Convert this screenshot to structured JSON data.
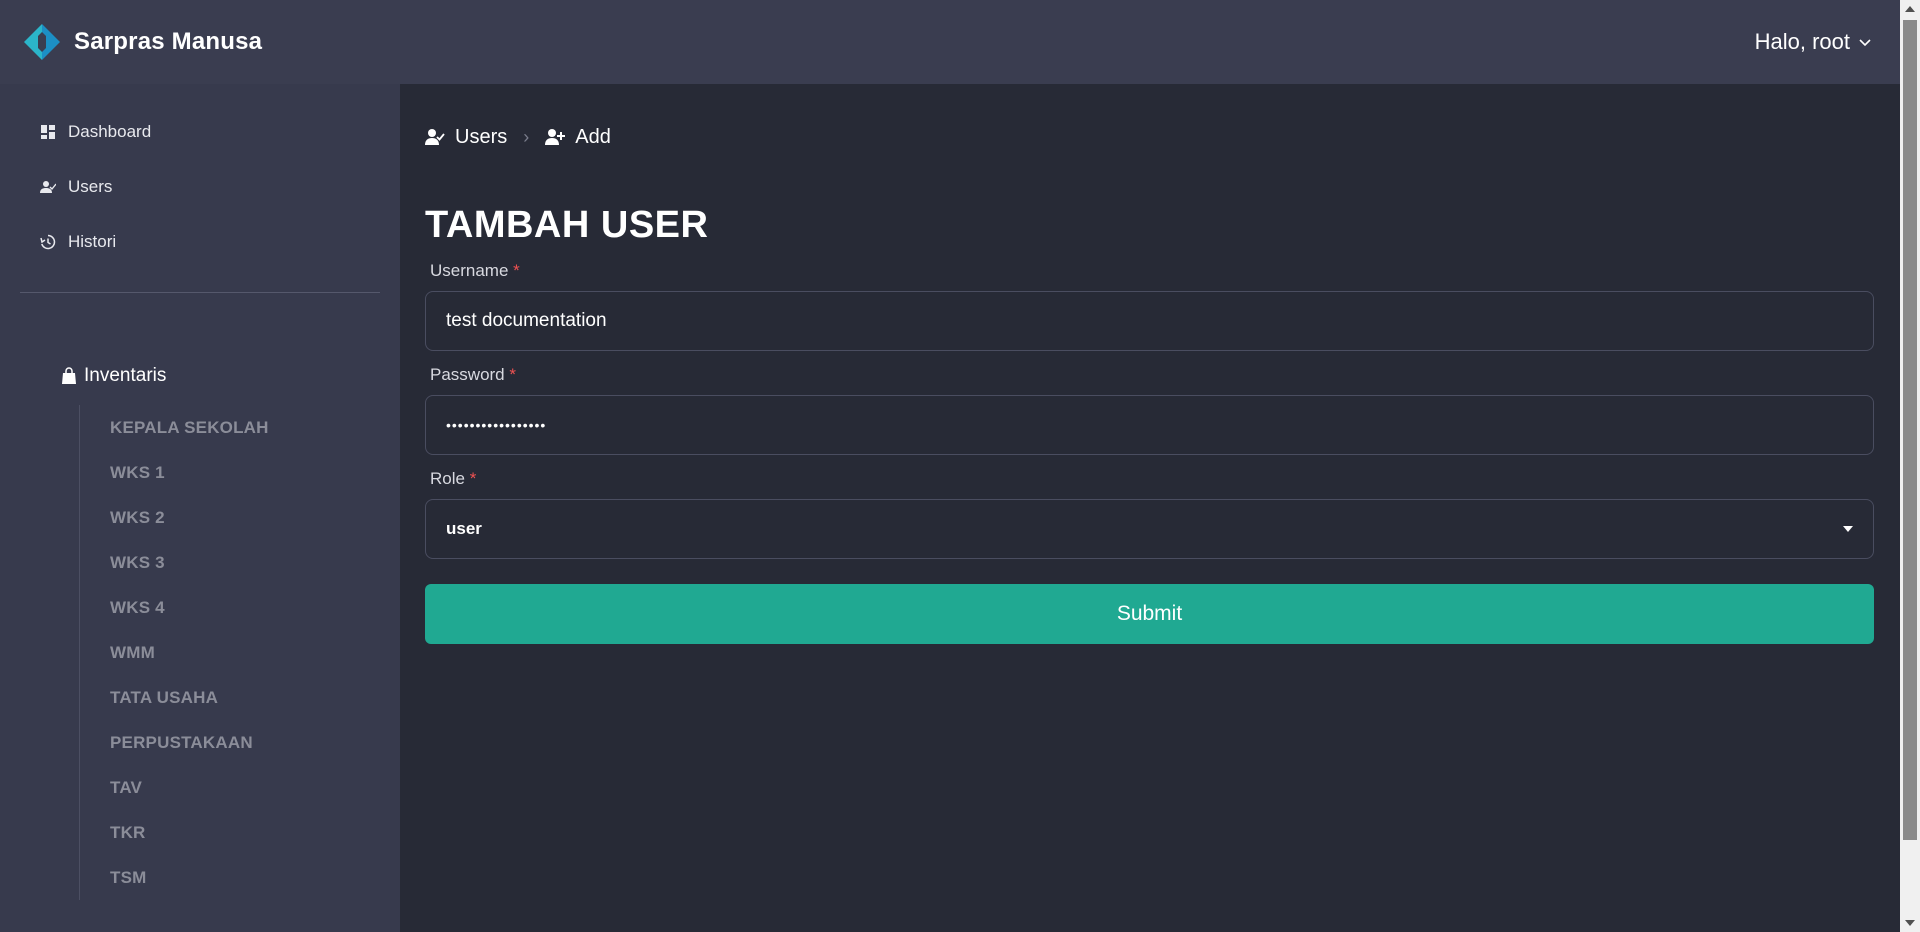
{
  "header": {
    "brand_name": "Sarpras Manusa",
    "user_greeting": "Halo, root"
  },
  "sidebar": {
    "nav": [
      {
        "label": "Dashboard",
        "icon": "dashboard-icon"
      },
      {
        "label": "Users",
        "icon": "user-check-icon"
      },
      {
        "label": "Histori",
        "icon": "history-icon"
      }
    ],
    "inventory_title": "Inventaris",
    "inventory_items": [
      "KEPALA SEKOLAH",
      "WKS 1",
      "WKS 2",
      "WKS 3",
      "WKS 4",
      "WMM",
      "TATA USAHA",
      "PERPUSTAKAAN",
      "TAV",
      "TKR",
      "TSM"
    ]
  },
  "breadcrumb": {
    "users": "Users",
    "add": "Add"
  },
  "form": {
    "title": "TAMBAH USER",
    "username_label": "Username",
    "username_value": "test documentation",
    "password_label": "Password",
    "password_value": "•••••••••••••••••",
    "role_label": "Role",
    "role_value": "user",
    "required_mark": "*",
    "submit_label": "Submit"
  },
  "colors": {
    "topbar": "#3a3d50",
    "sidebar": "#373a4d",
    "main": "#272a36",
    "accent": "#20a992",
    "required": "#f05252"
  }
}
